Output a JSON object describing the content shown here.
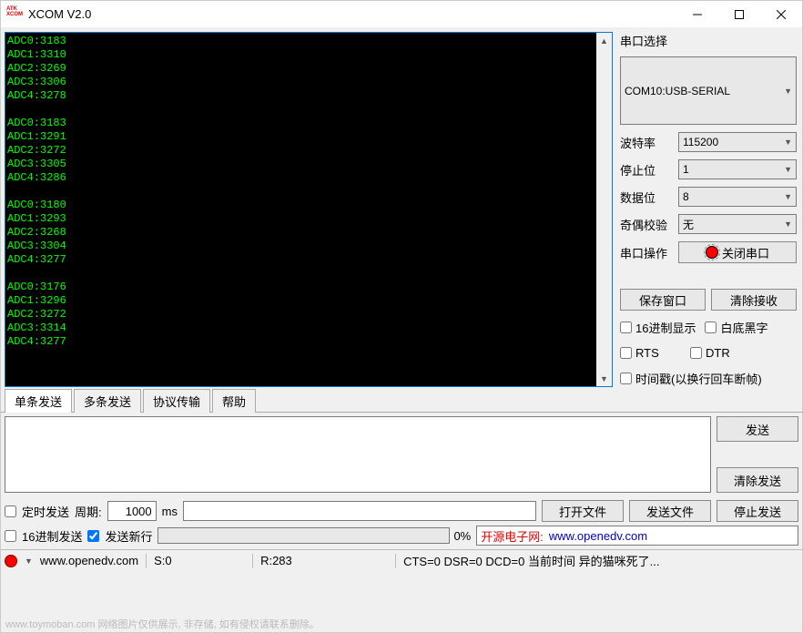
{
  "window": {
    "title": "XCOM V2.0",
    "logo_top": "ATK",
    "logo_bottom": "XCOM"
  },
  "console_lines": [
    "ADC0:3183",
    "ADC1:3310",
    "ADC2:3269",
    "ADC3:3306",
    "ADC4:3278",
    "",
    "ADC0:3183",
    "ADC1:3291",
    "ADC2:3272",
    "ADC3:3305",
    "ADC4:3286",
    "",
    "ADC0:3180",
    "ADC1:3293",
    "ADC2:3268",
    "ADC3:3304",
    "ADC4:3277",
    "",
    "ADC0:3176",
    "ADC1:3296",
    "ADC2:3272",
    "ADC3:3314",
    "ADC4:3277",
    ""
  ],
  "side": {
    "port_select_label": "串口选择",
    "port_value": "COM10:USB-SERIAL",
    "baud_label": "波特率",
    "baud_value": "115200",
    "stop_label": "停止位",
    "stop_value": "1",
    "data_label": "数据位",
    "data_value": "8",
    "parity_label": "奇偶校验",
    "parity_value": "无",
    "op_label": "串口操作",
    "op_button": "关闭串口",
    "save_window": "保存窗口",
    "clear_recv": "清除接收",
    "hex_display": "16进制显示",
    "white_bg": "白底黑字",
    "rts": "RTS",
    "dtr": "DTR",
    "timestamp": "时间戳(以换行回车断帧)"
  },
  "tabs": {
    "single": "单条发送",
    "multi": "多条发送",
    "protocol": "协议传输",
    "help": "帮助"
  },
  "send": {
    "send_btn": "发送",
    "clear_btn": "清除发送"
  },
  "timer": {
    "timed_send": "定时发送",
    "period_label": "周期:",
    "period_value": "1000",
    "period_unit": "ms",
    "open_file": "打开文件",
    "send_file": "发送文件",
    "stop_send": "停止发送",
    "hex_send": "16进制发送",
    "send_newline": "发送新行",
    "progress_pct": "0%",
    "open_link_label": "开源电子网:",
    "open_link_url": "www.openedv.com"
  },
  "status": {
    "url": "www.openedv.com",
    "s": "S:0",
    "r": "R:283",
    "line": "CTS=0 DSR=0 DCD=0 当前时间 异的猫咪死了..."
  },
  "watermark": "www.toymoban.com 网络图片仅供展示, 非存储, 如有侵权请联系删除。"
}
